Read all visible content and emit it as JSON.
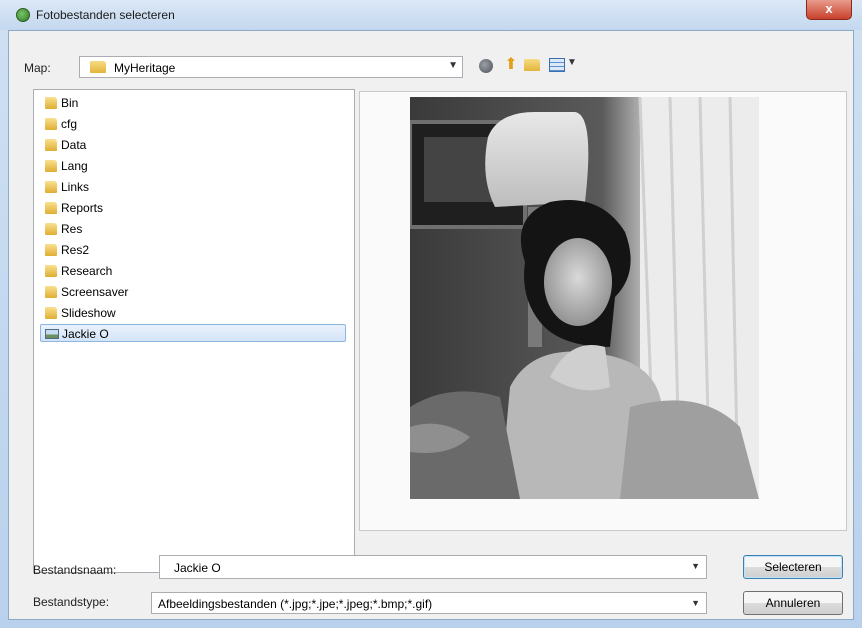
{
  "window": {
    "title": "Fotobestanden selecteren",
    "close_label": "x"
  },
  "toolbar": {
    "lookin_label": "Map:",
    "lookin_value": "MyHeritage",
    "icons": [
      "back-icon",
      "up-folder-icon",
      "new-folder-icon",
      "view-menu-icon"
    ]
  },
  "tree": {
    "items": [
      {
        "label": "Bin",
        "icon": "folder-icon"
      },
      {
        "label": "cfg",
        "icon": "folder-icon"
      },
      {
        "label": "Data",
        "icon": "folder-icon"
      },
      {
        "label": "Lang",
        "icon": "folder-icon"
      },
      {
        "label": "Links",
        "icon": "folder-icon"
      },
      {
        "label": "Reports",
        "icon": "folder-icon"
      },
      {
        "label": "Res",
        "icon": "folder-icon"
      },
      {
        "label": "Res2",
        "icon": "folder-icon"
      },
      {
        "label": "Research",
        "icon": "folder-icon"
      },
      {
        "label": "Screensaver",
        "icon": "folder-icon"
      },
      {
        "label": "Slideshow",
        "icon": "folder-icon"
      },
      {
        "label": "Jackie O",
        "icon": "image-file-icon",
        "selected": true
      }
    ]
  },
  "form": {
    "filename_label": "Bestandsnaam:",
    "filename_value": "Jackie O",
    "filetype_label": "Bestandstype:",
    "filetype_value": "Afbeeldingsbestanden (*.jpg;*.jpe;*.jpeg;*.bmp;*.gif)"
  },
  "buttons": {
    "select_label": "Selecteren",
    "cancel_label": "Annuleren"
  },
  "colors": {
    "accent": "#3c7fb1",
    "selection": "#d4e5f9",
    "close": "#c8412b"
  }
}
